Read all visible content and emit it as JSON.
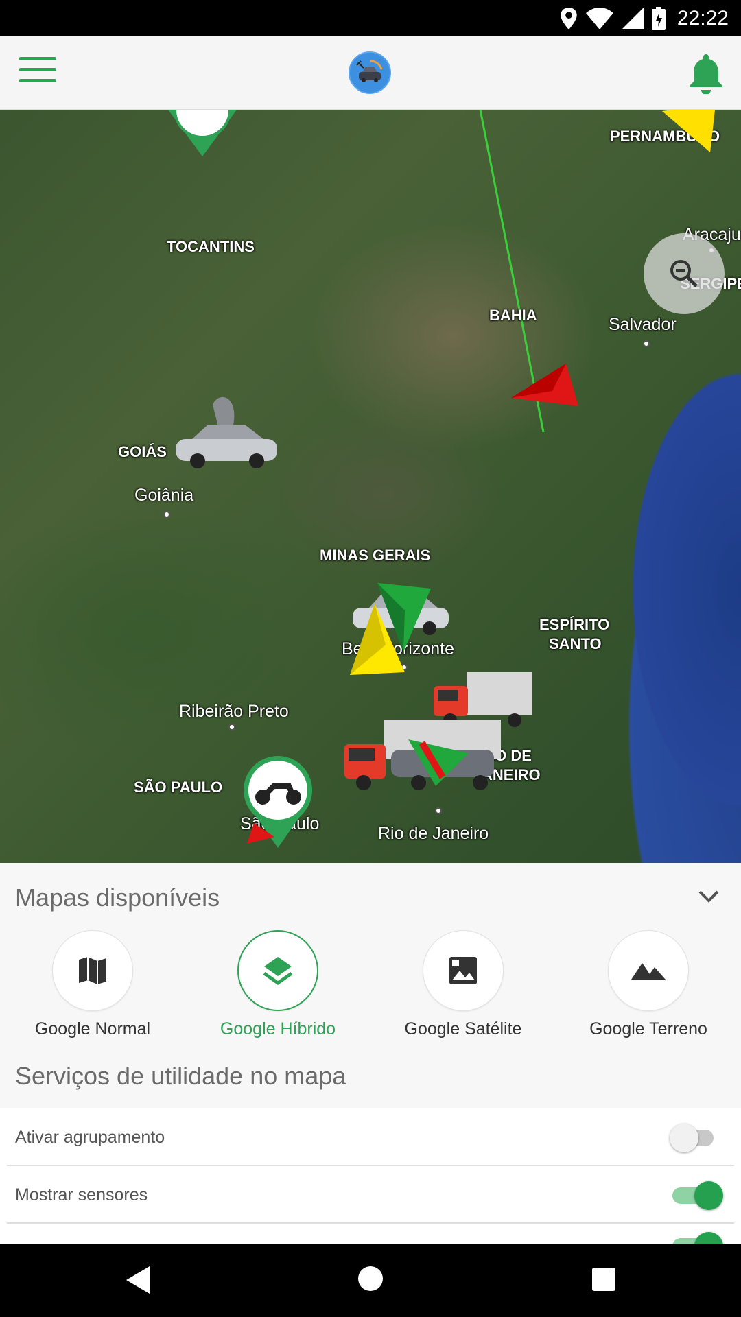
{
  "status_bar": {
    "time": "22:22"
  },
  "app_bar": {
    "title_logo": "car-logo-icon"
  },
  "map": {
    "labels": {
      "pernambuco": "PERNAMBUCO",
      "tocantins": "TOCANTINS",
      "bahia": "BAHIA",
      "sergipe": "SERGIPE",
      "goias": "GOIÁS",
      "minas_gerais": "MINAS GERAIS",
      "espirito_santo_1": "ESPÍRITO",
      "espirito_santo_2": "SANTO",
      "sao_paulo": "SÃO PAULO",
      "rio_1": "IO DE",
      "rio_2": "ANEIRO"
    },
    "cities": {
      "aracaju": "Aracaju",
      "salvador": "Salvador",
      "goiania": "Goiânia",
      "belo_horizonte": "Belo Horizonte",
      "ribeirao_preto": "Ribeirão Preto",
      "sao_paulo_city": "São Paulo",
      "rio_de_janeiro": "Rio de Janeiro"
    }
  },
  "maps_panel": {
    "title": "Mapas disponíveis",
    "options": [
      {
        "label": "Google Normal",
        "icon": "map-icon",
        "active": false
      },
      {
        "label": "Google Híbrido",
        "icon": "layers-icon",
        "active": true
      },
      {
        "label": "Google Satélite",
        "icon": "image-icon",
        "active": false
      },
      {
        "label": "Google Terreno",
        "icon": "terrain-icon",
        "active": false
      }
    ]
  },
  "services": {
    "title": "Serviços de utilidade no mapa",
    "items": [
      {
        "label": "Ativar agrupamento",
        "enabled": false
      },
      {
        "label": "Mostrar sensores",
        "enabled": true
      }
    ]
  },
  "colors": {
    "accent": "#2ea356",
    "map_water": "#27469a"
  }
}
